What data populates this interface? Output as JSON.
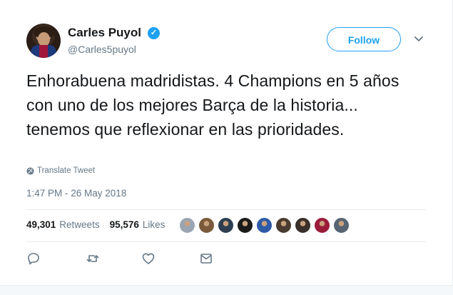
{
  "user": {
    "display_name": "Carles Puyol",
    "handle": "@Carles5puyol",
    "verified_glyph": "✓"
  },
  "follow_label": "Follow",
  "tweet": {
    "text": "Enhorabuena madridistas. 4 Champions en 5 años con uno de los mejores Barça de la historia... tenemos que reflexionar en las prioridades.",
    "translate_label": "Translate Tweet",
    "timestamp": "1:47 PM - 26 May 2018"
  },
  "stats": {
    "retweets_count": "49,301",
    "retweets_label": "Retweets",
    "likes_count": "95,576",
    "likes_label": "Likes"
  },
  "liker_avatars": [
    {
      "color": "#9aa5b1"
    },
    {
      "color": "#7a5a3a"
    },
    {
      "color": "#2c3e50"
    },
    {
      "color": "#1b1b1b"
    },
    {
      "color": "#2e5aa8"
    },
    {
      "color": "#4a3b30"
    },
    {
      "color": "#3a2f2a"
    },
    {
      "color": "#9b1c3a"
    },
    {
      "color": "#566573"
    }
  ],
  "colors": {
    "accent": "#1da1f2",
    "text": "#14171a",
    "secondary": "#657786",
    "border": "#e6ecf0"
  },
  "icons": [
    "verified-badge-icon",
    "chevron-down-icon",
    "globe-icon",
    "reply-icon",
    "retweet-icon",
    "like-icon",
    "direct-message-icon"
  ]
}
